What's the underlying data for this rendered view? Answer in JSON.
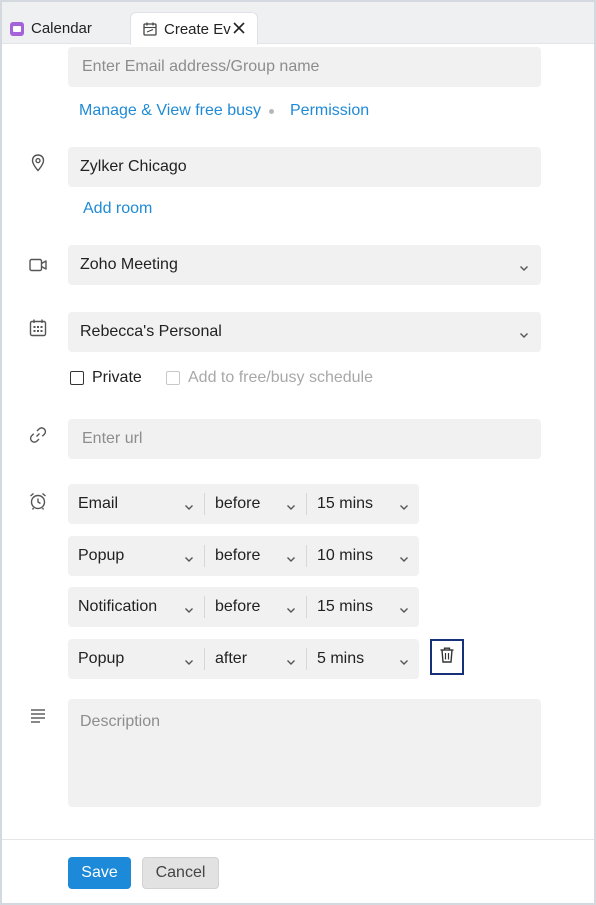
{
  "tabs": [
    {
      "label": "Calendar",
      "icon": "calendar-app-icon",
      "color": "#a463d8"
    },
    {
      "label": "Create Ev",
      "icon": "create-event-icon",
      "active": true
    }
  ],
  "attendees": {
    "placeholder": "Enter Email address/Group name",
    "manage_link": "Manage & View free busy",
    "permission_link": "Permission"
  },
  "location": {
    "value": "Zylker Chicago",
    "add_room": "Add room",
    "icon": "location-pin-icon"
  },
  "meeting": {
    "value": "Zoho Meeting",
    "icon": "video-camera-icon"
  },
  "calendar": {
    "value": "Rebecca's Personal",
    "icon": "calendar-grid-icon",
    "private_label": "Private",
    "freebusy_label": "Add to free/busy schedule"
  },
  "url": {
    "placeholder": "Enter url",
    "icon": "link-icon"
  },
  "reminders": {
    "icon": "alarm-clock-icon",
    "items": [
      {
        "type": "Email",
        "when": "before",
        "duration": "15 mins"
      },
      {
        "type": "Popup",
        "when": "before",
        "duration": "10 mins"
      },
      {
        "type": "Notification",
        "when": "before",
        "duration": "15 mins"
      },
      {
        "type": "Popup",
        "when": "after",
        "duration": "5 mins"
      }
    ],
    "delete_icon": "trash-icon"
  },
  "description": {
    "placeholder": "Description",
    "icon": "text-lines-icon"
  },
  "footer": {
    "save": "Save",
    "cancel": "Cancel"
  },
  "colors": {
    "accent": "#1d8ad9",
    "link": "#1f8ad6",
    "field_bg": "#f1f1f1",
    "focus_border": "#17307a"
  }
}
